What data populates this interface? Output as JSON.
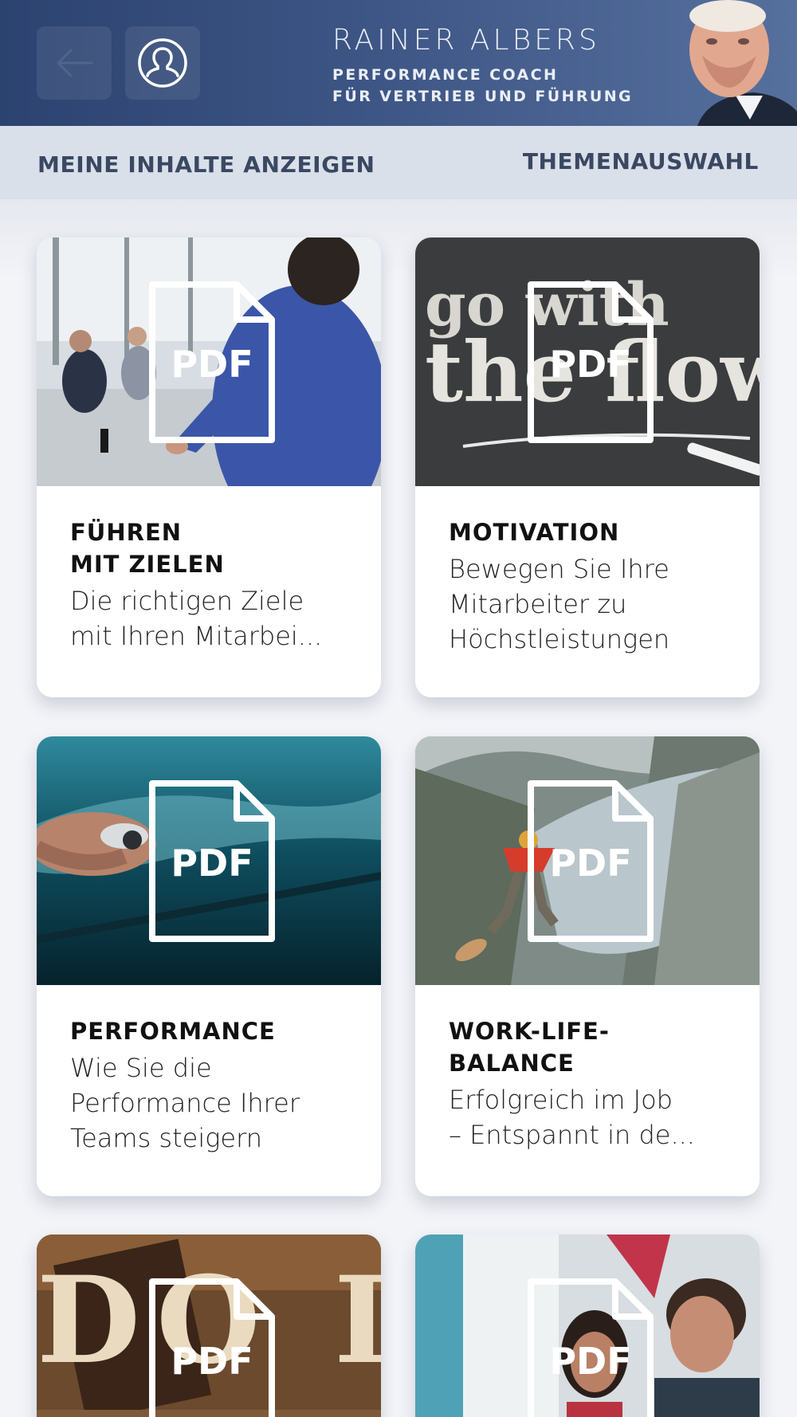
{
  "header": {
    "name": "RAINER ALBERS",
    "subtitle_line1": "PERFORMANCE COACH",
    "subtitle_line2": "FÜR VERTRIEB UND FÜHRUNG",
    "back_icon": "arrow-left-icon",
    "profile_icon": "user-profile-icon"
  },
  "subnav": {
    "left_label": "MEINE INHALTE ANZEIGEN",
    "right_label": "THEMENAUSWAHL"
  },
  "pdf_label": "PDF",
  "cards": [
    {
      "title": "FÜHREN\nMIT ZIELEN",
      "desc_line1": "Die richtigen Ziele",
      "desc_line2": "mit Ihren Mitarbei...",
      "desc_line3": ""
    },
    {
      "title": "MOTIVATION",
      "desc_line1": "Bewegen Sie Ihre",
      "desc_line2": "Mitarbeiter zu",
      "desc_line3": "Höchstleistungen"
    },
    {
      "title": "PERFORMANCE",
      "desc_line1": "Wie Sie die",
      "desc_line2": "Performance Ihrer",
      "desc_line3": "Teams steigern"
    },
    {
      "title": "WORK-LIFE-\nBALANCE",
      "desc_line1": "Erfolgreich im Job",
      "desc_line2": "– Entspannt in de...",
      "desc_line3": ""
    },
    {
      "title": "",
      "desc_line1": "",
      "desc_line2": "",
      "desc_line3": ""
    },
    {
      "title": "",
      "desc_line1": "",
      "desc_line2": "",
      "desc_line3": ""
    }
  ],
  "image_texts": {
    "card2_line1": "go with",
    "card2_line2": "the flow",
    "card5_text": "DO IT"
  },
  "colors": {
    "header": "#3d5584",
    "subnav": "#d9e0ea",
    "subnav_text": "#3b4862"
  }
}
